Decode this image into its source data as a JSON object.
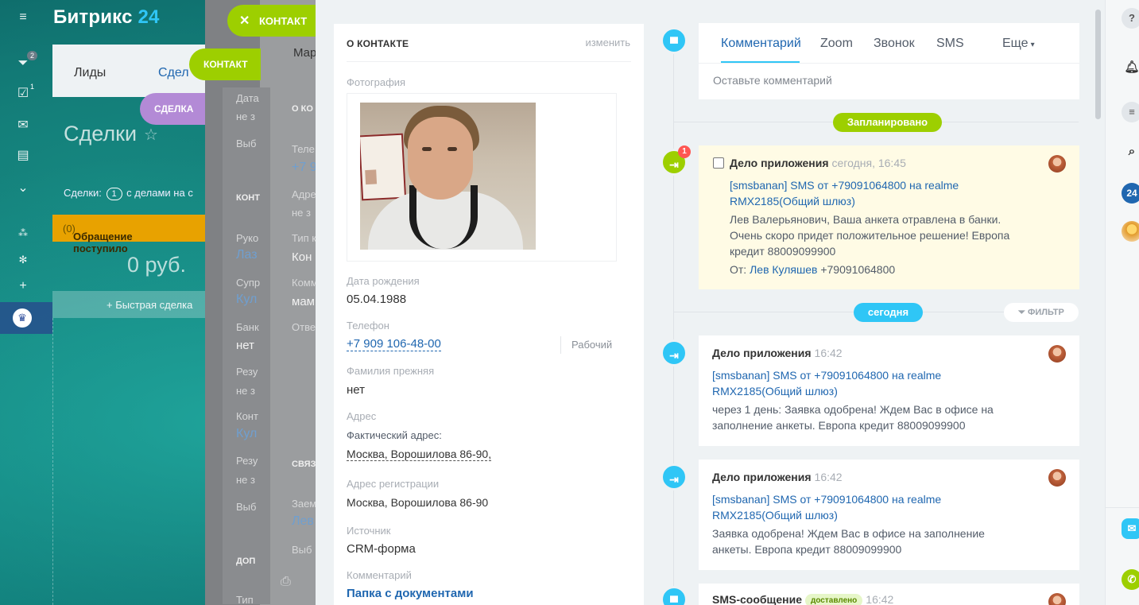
{
  "portal": {
    "logo_text": "Битрикс",
    "logo_num": "24",
    "nav_badges": [
      "2",
      "1"
    ],
    "tabs": {
      "leads": "Лиды",
      "deals": "Сдел"
    },
    "deals_title": "Сделки",
    "deals_sub_prefix": "Сделки:",
    "deals_sub_count": "1",
    "deals_sub_suffix": "с делами на с",
    "stage_name": "Обращение поступило",
    "stage_count": "(0)",
    "stage_sum": "0 руб.",
    "quick_deal": "+ Быстрая сделка"
  },
  "slider_buttons": {
    "contact_top": "КОНТАКТ",
    "contact_second": "КОНТАКТ",
    "deal": "СДЕЛКА"
  },
  "middle_panel": {
    "tab_fragment": "Мар",
    "cells": [
      "Дата",
      "не з",
      "Выб",
      "О КО",
      "Теле",
      "+7 9",
      "Адре",
      "не з",
      "Тип к",
      "Кон",
      "Комм",
      "мам",
      "Отве",
      "Руко",
      "Лаз",
      "Супр",
      "Кул",
      "Банк",
      "нет",
      "Резу",
      "не з",
      "Конт",
      "Кул",
      "Резу",
      "не з",
      "Выб",
      "КОНТ",
      "СВЯЗ",
      "Заем",
      "Лев",
      "Выб",
      "ДОП",
      "Тип"
    ]
  },
  "contact_card": {
    "section_title": "О КОНТАКТЕ",
    "edit_label": "изменить",
    "photo_label": "Фотография",
    "birth_label": "Дата рождения",
    "birth_value": "05.04.1988",
    "phone_label": "Телефон",
    "phone_value": "+7 909 106-48-00",
    "phone_type": "Рабочий",
    "prev_surname_label": "Фамилия прежняя",
    "prev_surname_value": "нет",
    "address_label": "Адрес",
    "fact_address_label": "Фактический адрес:",
    "fact_address_value": "Москва, Ворошилова 86-90,",
    "reg_address_label": "Адрес регистрации",
    "reg_address_value": "Москва, Ворошилова 86-90",
    "source_label": "Источник",
    "source_value": "CRM-форма",
    "comment_label": "Комментарий",
    "comment_value": "Папка с документами"
  },
  "composer": {
    "tabs": [
      "Комментарий",
      "Zoom",
      "Звонок",
      "SMS",
      "Еще"
    ],
    "placeholder": "Оставьте комментарий"
  },
  "timeline": {
    "planned_label": "Запланировано",
    "today_label": "сегодня",
    "filter_label": "ФИЛЬТР",
    "planned_item": {
      "title": "Дело приложения",
      "time": "сегодня, 16:45",
      "notify_count": "1",
      "link": "[smsbanan] SMS от +79091064800 на realme RMX2185(Общий шлюз)",
      "text": "Лев  Валерьянович, Ваша анкета отравлена в банки. Очень скоро придет положительное решение! Европа кредит 88009099900",
      "from_label": "От:",
      "from_name": "Лев Куляшев",
      "from_phone": "+79091064800"
    },
    "items": [
      {
        "title": "Дело приложения",
        "time": "16:42",
        "link": "[smsbanan] SMS от +79091064800 на realme RMX2185(Общий шлюз)",
        "text": "через 1 день: Заявка одобрена! Ждем Вас в офисе на заполнение анкеты. Европа кредит 88009099900"
      },
      {
        "title": "Дело приложения",
        "time": "16:42",
        "link": "[smsbanan] SMS от +79091064800 на realme RMX2185(Общий шлюз)",
        "text": "Заявка одобрена! Ждем Вас в офисе на заполнение анкеты. Европа кредит 88009099900"
      },
      {
        "title": "SMS-сообщение",
        "badge": "доставлено",
        "time": "16:42"
      }
    ]
  },
  "right_strip": {
    "help": "?",
    "b24": "24"
  },
  "colors": {
    "accent_blue": "#2fc6f6",
    "link_blue": "#2067b0",
    "green": "#9dcf00",
    "purple": "#b38ad6",
    "stage_orange": "#e8a200"
  }
}
